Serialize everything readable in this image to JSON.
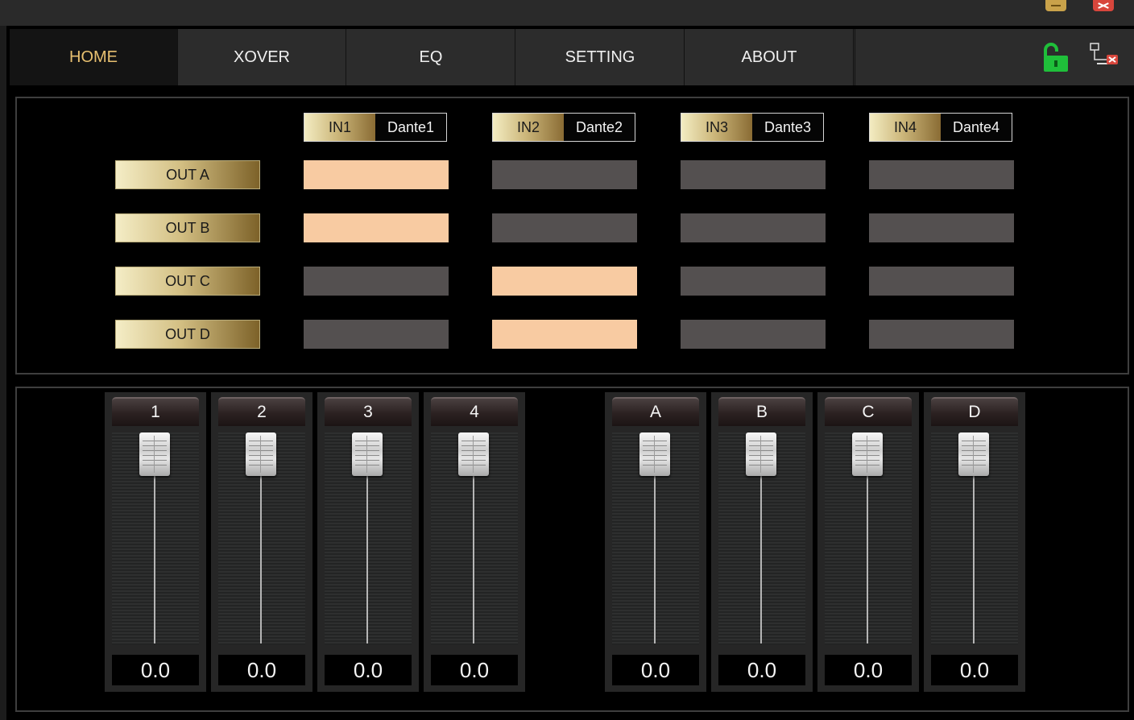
{
  "nav": {
    "tabs": [
      {
        "label": "HOME",
        "active": true
      },
      {
        "label": "XOVER",
        "active": false
      },
      {
        "label": "EQ",
        "active": false
      },
      {
        "label": "SETTING",
        "active": false
      },
      {
        "label": "ABOUT",
        "active": false
      }
    ],
    "icons": [
      "unlock-icon",
      "disconnect-icon"
    ]
  },
  "routing": {
    "inputs": [
      {
        "label": "IN1",
        "name": "Dante1"
      },
      {
        "label": "IN2",
        "name": "Dante2"
      },
      {
        "label": "IN3",
        "name": "Dante3"
      },
      {
        "label": "IN4",
        "name": "Dante4"
      }
    ],
    "outputs": [
      "OUT A",
      "OUT B",
      "OUT C",
      "OUT D"
    ],
    "matrix": [
      [
        true,
        false,
        false,
        false
      ],
      [
        true,
        false,
        false,
        false
      ],
      [
        false,
        true,
        false,
        false
      ],
      [
        false,
        true,
        false,
        false
      ]
    ],
    "colors": {
      "on": "#f8cba2",
      "off": "#545050"
    }
  },
  "faders": {
    "input_channels": [
      {
        "label": "1",
        "value": "0.0"
      },
      {
        "label": "2",
        "value": "0.0"
      },
      {
        "label": "3",
        "value": "0.0"
      },
      {
        "label": "4",
        "value": "0.0"
      }
    ],
    "output_channels": [
      {
        "label": "A",
        "value": "0.0"
      },
      {
        "label": "B",
        "value": "0.0"
      },
      {
        "label": "C",
        "value": "0.0"
      },
      {
        "label": "D",
        "value": "0.0"
      }
    ],
    "level_fraction": 1.0
  },
  "colors": {
    "accent": "#e8c070",
    "background": "#000000"
  }
}
